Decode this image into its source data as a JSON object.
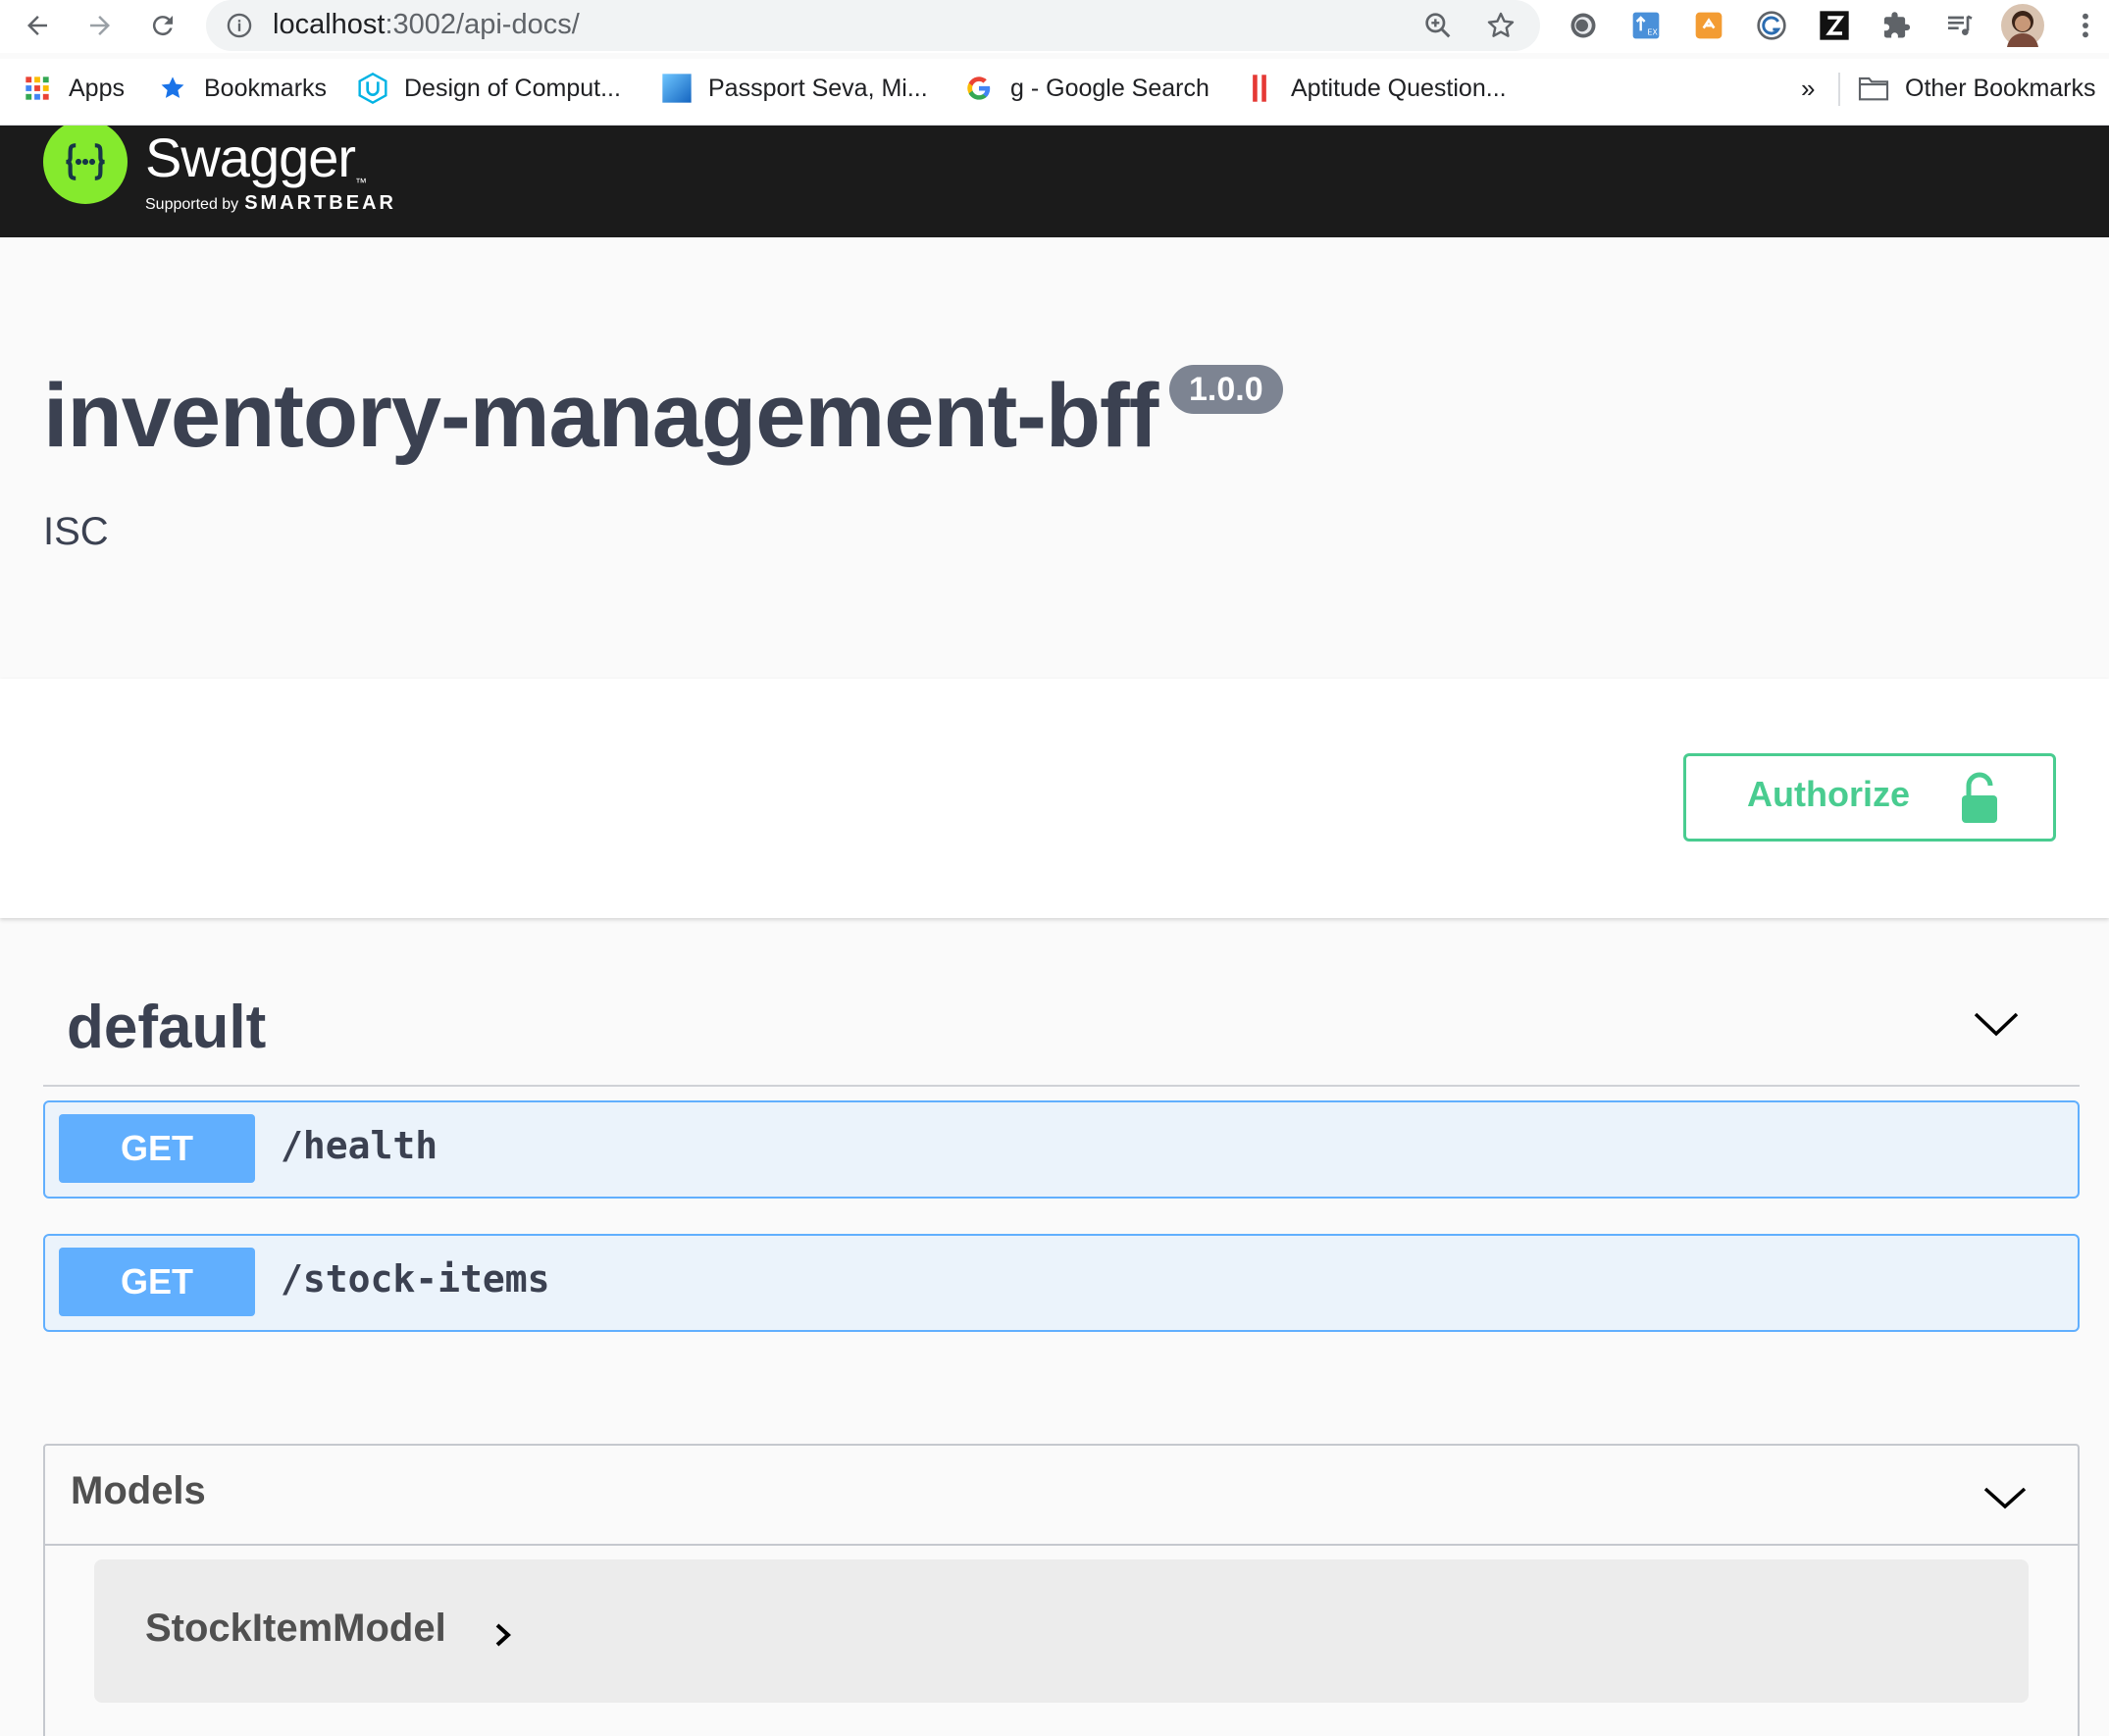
{
  "browser": {
    "url_host": "localhost",
    "url_path": ":3002/api-docs/",
    "bookmarks": [
      {
        "label": "Apps",
        "icon": "apps-grid-icon"
      },
      {
        "label": "Bookmarks",
        "icon": "star-icon"
      },
      {
        "label": "Design of Comput...",
        "icon": "udacity-icon"
      },
      {
        "label": "Passport Seva, Mi...",
        "icon": "blue-square-icon"
      },
      {
        "label": "g - Google Search",
        "icon": "google-icon"
      },
      {
        "label": "Aptitude Question...",
        "icon": "red-bars-icon"
      }
    ],
    "overflow_label": "»",
    "other_bookmarks": "Other Bookmarks",
    "extensions": [
      "circle-extension-icon",
      "translate-extension-icon",
      "orange-extension-icon",
      "grammarly-icon",
      "z-extension-icon",
      "puzzle-icon",
      "media-icon",
      "profile-avatar",
      "more-menu-icon"
    ]
  },
  "swagger": {
    "logo_word": "Swagger",
    "logo_tm": "™",
    "supported_by": "Supported by",
    "brand": "SMARTBEAR",
    "brand_color": "#85ea2d"
  },
  "info": {
    "title": "inventory-management-bff",
    "version": "1.0.0",
    "description": "ISC"
  },
  "auth": {
    "label": "Authorize",
    "color": "#49cc90"
  },
  "tag": {
    "name": "default",
    "operations": [
      {
        "method": "GET",
        "path": "/health"
      },
      {
        "method": "GET",
        "path": "/stock-items"
      }
    ],
    "get_color": "#61affe"
  },
  "models": {
    "title": "Models",
    "items": [
      {
        "name": "StockItemModel"
      }
    ]
  }
}
